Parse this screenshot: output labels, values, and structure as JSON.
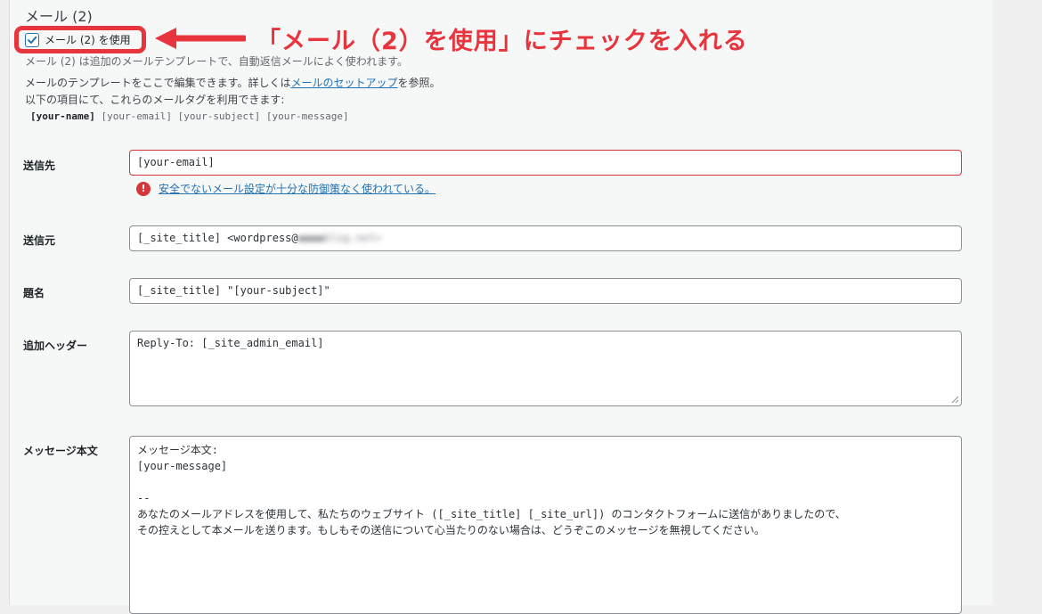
{
  "section": {
    "title": "メール (2)",
    "use_checkbox_label": "メール (2) を使用",
    "use_checkbox_checked": true
  },
  "annotation": {
    "text": "「メール（2）を使用」にチェックを入れる",
    "color": "#e8343c"
  },
  "description": {
    "line1": "メール (2) は追加のメールテンプレートで、自動返信メールによく使われます。",
    "line2_before": "メールのテンプレートをここで編集できます。詳しくは",
    "line2_link": "メールのセットアップ",
    "line2_after": "を参照。",
    "line3": "以下の項目にて、これらのメールタグを利用できます:"
  },
  "mail_tags": {
    "primary": "[your-name]",
    "others": "[your-email] [your-subject] [your-message]"
  },
  "fields": {
    "to": {
      "label": "送信先",
      "value": "[your-email]"
    },
    "warning": {
      "text": "安全でないメール設定が十分な防御策なく使われている。",
      "icon": "error-icon",
      "color": "#d63638"
    },
    "from": {
      "label": "送信元",
      "value": "[_site_title] <wordpress@",
      "blurred": "●●●●blog.net>"
    },
    "subject": {
      "label": "題名",
      "value": "[_site_title] \"[your-subject]\""
    },
    "headers": {
      "label": "追加ヘッダー",
      "value": "Reply-To: [_site_admin_email]"
    },
    "body": {
      "label": "メッセージ本文",
      "value": "メッセージ本文:\n[your-message]\n\n--\nあなたのメールアドレスを使用して、私たちのウェブサイト ([_site_title] [_site_url]) のコンタクトフォームに送信がありましたので、\nその控えとして本メールを送ります。もしもその送信について心当たりのない場合は、どうぞこのメッセージを無視してください。"
    }
  },
  "colors": {
    "accent": "#2271b1",
    "error": "#d63638",
    "annotation": "#e8343c"
  }
}
